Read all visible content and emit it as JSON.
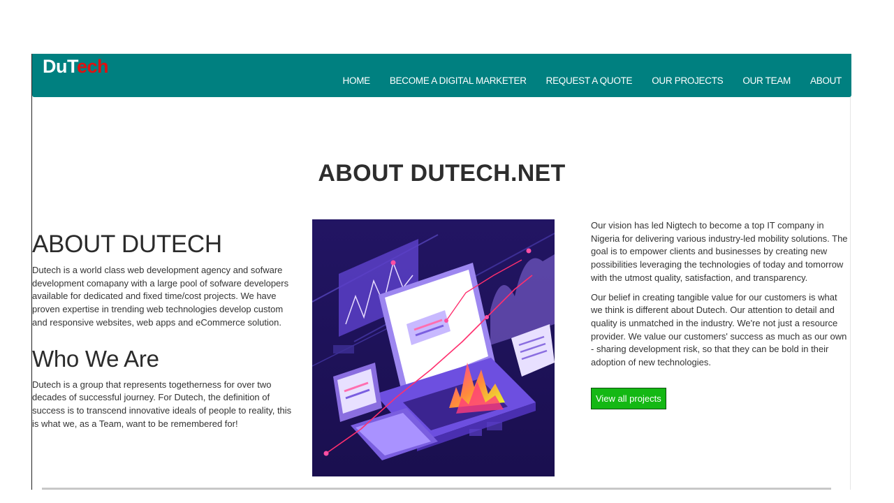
{
  "header": {
    "logo_part1": "DuT",
    "logo_part2": "ech",
    "nav": [
      "HOME",
      "BECOME A DIGITAL MARKETER",
      "REQUEST A QUOTE",
      "OUR PROJECTS",
      "OUR TEAM",
      "ABOUT"
    ]
  },
  "main": {
    "title": "ABOUT DUTECH.NET",
    "about_heading": "ABOUT DUTECH",
    "about_text": "Dutech is a world class web development agency and sofware development comapany with a large pool of sofware developers available for dedicated and fixed time/cost projects. We have proven expertise in trending web technologies develop custom and responsive websites, web apps and eCommerce solution.",
    "who_heading": "Who We Are",
    "who_text": "Dutech is a group that represents togetherness for over two decades of successful journey. For Dutech, the definition of success is to transcend innovative ideals of people to reality, this is what we, as a Team, want to be remembered for!",
    "vision_text": "Our vision has led Nigtech to become a top IT company in Nigeria for delivering various industry-led mobility solutions. The goal is to empower clients and businesses by creating new possibilities leveraging the technologies of today and tomorrow with the utmost quality, satisfaction, and transparency.",
    "belief_text": "Our belief in creating tangible value for our customers is what we think is different about Dutech. Our attention to detail and quality is unmatched in the industry. We're not just a resource provider. We value our customers' success as much as our own - sharing development risk, so that they can be bold in their adoption of new technologies.",
    "button_label": "View all projects"
  },
  "colors": {
    "navbar": "#008080",
    "logo_white": "#ffffff",
    "logo_red": "#e01010",
    "button": "#14b814"
  }
}
